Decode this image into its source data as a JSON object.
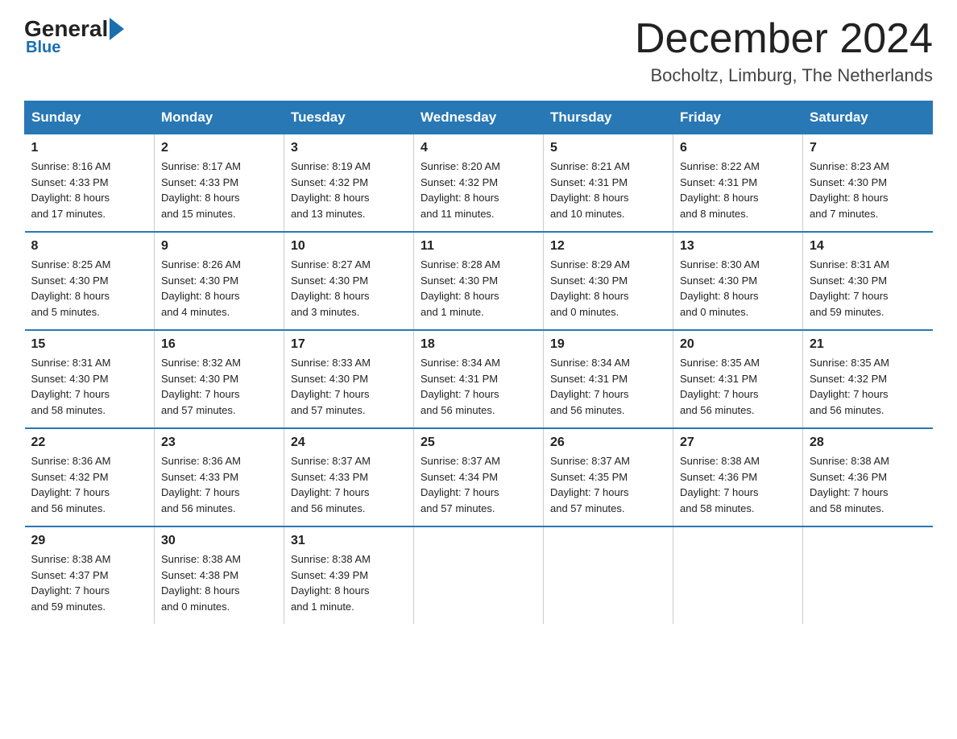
{
  "logo": {
    "general": "General",
    "blue": "Blue"
  },
  "header": {
    "month": "December 2024",
    "location": "Bocholtz, Limburg, The Netherlands"
  },
  "days_of_week": [
    "Sunday",
    "Monday",
    "Tuesday",
    "Wednesday",
    "Thursday",
    "Friday",
    "Saturday"
  ],
  "weeks": [
    [
      {
        "day": "1",
        "sunrise": "8:16 AM",
        "sunset": "4:33 PM",
        "daylight": "8 hours and 17 minutes."
      },
      {
        "day": "2",
        "sunrise": "8:17 AM",
        "sunset": "4:33 PM",
        "daylight": "8 hours and 15 minutes."
      },
      {
        "day": "3",
        "sunrise": "8:19 AM",
        "sunset": "4:32 PM",
        "daylight": "8 hours and 13 minutes."
      },
      {
        "day": "4",
        "sunrise": "8:20 AM",
        "sunset": "4:32 PM",
        "daylight": "8 hours and 11 minutes."
      },
      {
        "day": "5",
        "sunrise": "8:21 AM",
        "sunset": "4:31 PM",
        "daylight": "8 hours and 10 minutes."
      },
      {
        "day": "6",
        "sunrise": "8:22 AM",
        "sunset": "4:31 PM",
        "daylight": "8 hours and 8 minutes."
      },
      {
        "day": "7",
        "sunrise": "8:23 AM",
        "sunset": "4:30 PM",
        "daylight": "8 hours and 7 minutes."
      }
    ],
    [
      {
        "day": "8",
        "sunrise": "8:25 AM",
        "sunset": "4:30 PM",
        "daylight": "8 hours and 5 minutes."
      },
      {
        "day": "9",
        "sunrise": "8:26 AM",
        "sunset": "4:30 PM",
        "daylight": "8 hours and 4 minutes."
      },
      {
        "day": "10",
        "sunrise": "8:27 AM",
        "sunset": "4:30 PM",
        "daylight": "8 hours and 3 minutes."
      },
      {
        "day": "11",
        "sunrise": "8:28 AM",
        "sunset": "4:30 PM",
        "daylight": "8 hours and 1 minute."
      },
      {
        "day": "12",
        "sunrise": "8:29 AM",
        "sunset": "4:30 PM",
        "daylight": "8 hours and 0 minutes."
      },
      {
        "day": "13",
        "sunrise": "8:30 AM",
        "sunset": "4:30 PM",
        "daylight": "8 hours and 0 minutes."
      },
      {
        "day": "14",
        "sunrise": "8:31 AM",
        "sunset": "4:30 PM",
        "daylight": "7 hours and 59 minutes."
      }
    ],
    [
      {
        "day": "15",
        "sunrise": "8:31 AM",
        "sunset": "4:30 PM",
        "daylight": "7 hours and 58 minutes."
      },
      {
        "day": "16",
        "sunrise": "8:32 AM",
        "sunset": "4:30 PM",
        "daylight": "7 hours and 57 minutes."
      },
      {
        "day": "17",
        "sunrise": "8:33 AM",
        "sunset": "4:30 PM",
        "daylight": "7 hours and 57 minutes."
      },
      {
        "day": "18",
        "sunrise": "8:34 AM",
        "sunset": "4:31 PM",
        "daylight": "7 hours and 56 minutes."
      },
      {
        "day": "19",
        "sunrise": "8:34 AM",
        "sunset": "4:31 PM",
        "daylight": "7 hours and 56 minutes."
      },
      {
        "day": "20",
        "sunrise": "8:35 AM",
        "sunset": "4:31 PM",
        "daylight": "7 hours and 56 minutes."
      },
      {
        "day": "21",
        "sunrise": "8:35 AM",
        "sunset": "4:32 PM",
        "daylight": "7 hours and 56 minutes."
      }
    ],
    [
      {
        "day": "22",
        "sunrise": "8:36 AM",
        "sunset": "4:32 PM",
        "daylight": "7 hours and 56 minutes."
      },
      {
        "day": "23",
        "sunrise": "8:36 AM",
        "sunset": "4:33 PM",
        "daylight": "7 hours and 56 minutes."
      },
      {
        "day": "24",
        "sunrise": "8:37 AM",
        "sunset": "4:33 PM",
        "daylight": "7 hours and 56 minutes."
      },
      {
        "day": "25",
        "sunrise": "8:37 AM",
        "sunset": "4:34 PM",
        "daylight": "7 hours and 57 minutes."
      },
      {
        "day": "26",
        "sunrise": "8:37 AM",
        "sunset": "4:35 PM",
        "daylight": "7 hours and 57 minutes."
      },
      {
        "day": "27",
        "sunrise": "8:38 AM",
        "sunset": "4:36 PM",
        "daylight": "7 hours and 58 minutes."
      },
      {
        "day": "28",
        "sunrise": "8:38 AM",
        "sunset": "4:36 PM",
        "daylight": "7 hours and 58 minutes."
      }
    ],
    [
      {
        "day": "29",
        "sunrise": "8:38 AM",
        "sunset": "4:37 PM",
        "daylight": "7 hours and 59 minutes."
      },
      {
        "day": "30",
        "sunrise": "8:38 AM",
        "sunset": "4:38 PM",
        "daylight": "8 hours and 0 minutes."
      },
      {
        "day": "31",
        "sunrise": "8:38 AM",
        "sunset": "4:39 PM",
        "daylight": "8 hours and 1 minute."
      },
      null,
      null,
      null,
      null
    ]
  ],
  "labels": {
    "sunrise": "Sunrise:",
    "sunset": "Sunset:",
    "daylight": "Daylight:"
  }
}
